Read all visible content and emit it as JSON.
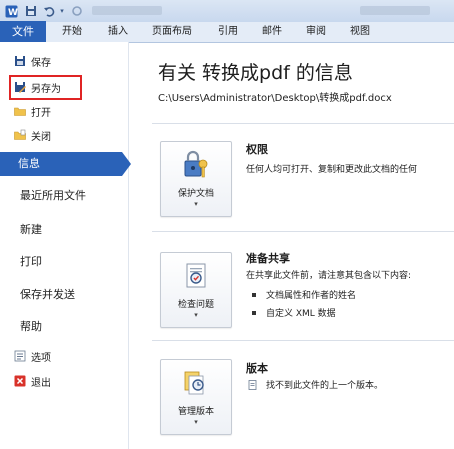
{
  "ribbon": {
    "file_tab": "文件",
    "tabs": [
      "开始",
      "插入",
      "页面布局",
      "引用",
      "邮件",
      "审阅",
      "视图"
    ]
  },
  "backstage": {
    "small_items": [
      {
        "label": "保存",
        "icon": "save-icon"
      },
      {
        "label": "另存为",
        "icon": "save-as-icon"
      },
      {
        "label": "打开",
        "icon": "open-folder-icon"
      },
      {
        "label": "关闭",
        "icon": "close-doc-icon"
      }
    ],
    "active_item": "信息",
    "big_items": [
      "最近所用文件",
      "新建",
      "打印",
      "保存并发送",
      "帮助"
    ],
    "bottom_items": [
      {
        "label": "选项",
        "icon": "options-icon"
      },
      {
        "label": "退出",
        "icon": "exit-icon"
      }
    ]
  },
  "info": {
    "title": "有关 转换成pdf 的信息",
    "path": "C:\\Users\\Administrator\\Desktop\\转换成pdf.docx",
    "sections": [
      {
        "button_label": "保护文档",
        "button_icon": "lock-key-icon",
        "title": "权限",
        "text": "任何人均可打开、复制和更改此文档的任何",
        "bullets": []
      },
      {
        "button_label": "检查问题",
        "button_icon": "inspect-document-icon",
        "title": "准备共享",
        "text": "在共享此文件前，请注意其包含以下内容:",
        "bullets": [
          "文档属性和作者的姓名",
          "自定义 XML 数据"
        ]
      },
      {
        "button_label": "管理版本",
        "button_icon": "versions-icon",
        "title": "版本",
        "text": "找不到此文件的上一个版本。",
        "bullets": []
      }
    ]
  },
  "colors": {
    "accent": "#2a62b8",
    "highlight": "#e02424"
  }
}
